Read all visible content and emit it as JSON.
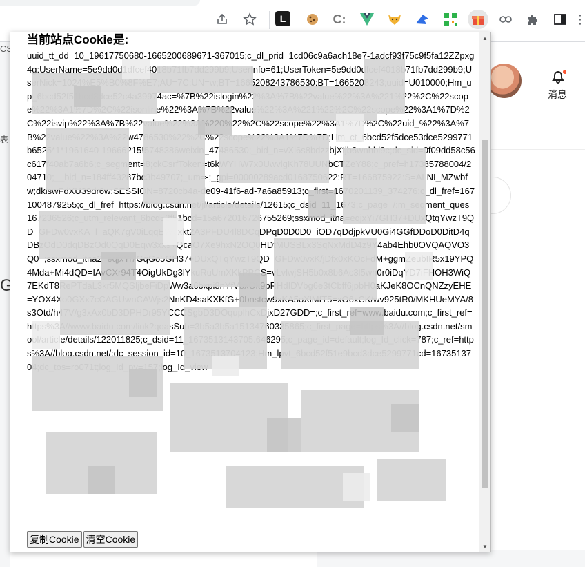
{
  "browser": {
    "icons": [
      {
        "name": "share-icon",
        "glyph": "⇪"
      },
      {
        "name": "bookmark-star-icon",
        "glyph": "☆"
      },
      {
        "name": "extension-l-icon",
        "glyph": "L"
      },
      {
        "name": "extension-cookie-icon",
        "glyph": "🍪"
      },
      {
        "name": "extension-c-icon",
        "glyph": "C"
      },
      {
        "name": "extension-vue-icon",
        "glyph": "▼"
      },
      {
        "name": "extension-fox-icon",
        "glyph": "🦊"
      },
      {
        "name": "extension-bird-icon",
        "glyph": "🐦"
      },
      {
        "name": "extension-qr-icon",
        "glyph": "▦"
      },
      {
        "name": "extension-gift-icon",
        "glyph": "🎁"
      },
      {
        "name": "extension-link-icon",
        "glyph": "∞"
      },
      {
        "name": "extensions-puzzle-icon",
        "glyph": "✚"
      },
      {
        "name": "side-panel-icon",
        "glyph": "◧"
      },
      {
        "name": "more-menu-icon",
        "glyph": "⋮"
      }
    ]
  },
  "background": {
    "left_fragments": [
      "CS",
      "表",
      "G"
    ],
    "bell_label": "消息"
  },
  "popup": {
    "title": "当前站点Cookie是:",
    "cookie_text": "uuid_tt_dd=10_19617750680-1665200689671-367015;c_dl_prid=1cd06c9a6ach18e7-1adcf93f75c9f5fa12ZZpxg4g;UserName=5e9dd0d1dfcef4018b71fb7dd299b9;UserInfo=61;UserToken=5e9dd0dfcef4018b71fb7dd299b9;UserNick=1024%E5%B0%8F%E7;AU=7C;UN=w;BT=1665208243786530;BT=1665208243;uuid=U010000;Hm_up_6bcd52f51bcd3dce52c4a39974ac=%7B%22islogin%22%3A%7B%22value%22%3A%221%22%2C%22scope%22%3A1%7D%2C%22isonline%22%3A%7B%22value%22%3A%221%22%2C%22scope%22%3A1%7D%2C%22isvip%22%3A%7B%22value%22%3A%220%22%2C%22scope%22%3A1%7D%2C%22uid_%22%3A%7B%22value%22%3A%22w4786530%22%2C%22scope%22%3A1%7D%7D;Hm_ct_6bcd52f5dce53dce5299771b6525*1*1961640-19666215!5748386weixin_47486530;_bid_n=vXl6s8bdzzbjXtjb6wnhbl9c;dc_sid=0f09dd58c56c617f40ab7a6b6;c_segment=8;ckCsrfToken=t6kWYHW7x0UwvlgKh78UUNbCTZeY88;c_pref=h17385788004/204710;__bid_n=184ff43287bc3b49707;_um=-;_gpi=00000289acd0168750622:RT=166875922:S=ALNI_MZwbfw;dklswFdXU39dr6w;SESSION=8720cb4a-de09-41f6-ad-7a6a85913;c_first=1670201139_374276;c_dl_fref=1671004879255;c_dl_fref=https://blog.csdn.net/jl/article/details/12615;c_dsid=11_1673;c_page=/;m_segment_ques=167236526;c_utm_relevant_6bcd52f51bcd=15a672016726755269;ssxmod_itna=eqjxYi7GH37+DUxQtqYwzT9QD=GFDw0vxKA=l=aQK7gV0iLqqEWpxkt2A3PFDU4l8DCqDPqD0D0D0=iOD7qDdjpkVU0Gi4GGfDDoD0DitD4qDBzOdD0dqDBzOd0QqD0Eqw3xx9+QcaO7Xe9hxN2OQ0HDtMUSBLx3SqNxMdD4z9Y4ab4Ehb0OVQAQVO3Q0=;ssxmod_itna2=eqjxYi7GqGo5GH37+DUxQTqYwzT9QD=GFDw0vxK/jDfx0xKOcFdM+ggmZeubIR5x19YPQ4Mda+Mi4dQD=IAvCXr94T4OigUkDg3lYkuRuUmXKkPPCS=vLvlwjSH5b0x8b6Ac3l5wh0r0iDqYD7iFHOH3WiQ7EKdT8RePTdaL3kr5MQSIjbeFiDpWw3a6bxpi8nYfVbxOk9pRHdIDVbg6e3tCbff6jpbH0aKJeK8OCnQNZzyEHE=YOX4Xo0GXx7cCAGUwnCAWjs2NnKD4saKXKfG+0bnstcw9xKA5oXlMfT5=xO6xCK/wv925tR0/MKHUeMYA/8s3Otd/h47V/g3xAx0bD3DPHDr95YCCCSgbD3DOquplhCxDjxD27GDD=;c_first_ref=www.baidu.com;c_first_ref=https%3A//www.baidu.com/link?qoasSub=3b5a3b5a15134760335865;c_first_page=https%3A//blog.csdn.net/smool/article/details/122011825;c_dsid=11_1673513143705.646295;c_page_id=default;log_Id_click=787;c_ref=https%3A//blog.csdn.net/;dc_session_id=10_1673513704123;Hm_lpvt_6bcd52f51e9bcd3dce5299771cd=1673513704;dc_tos=ro071t;log_Id_pv=157;log_Id_view",
    "copy_button": "复制Cookie",
    "clear_button": "清空Cookie"
  },
  "colors": {
    "popup_border": "#bdbdbd",
    "scroll_thumb": "#c1c1c1",
    "bell_dot": "#fc5531"
  }
}
